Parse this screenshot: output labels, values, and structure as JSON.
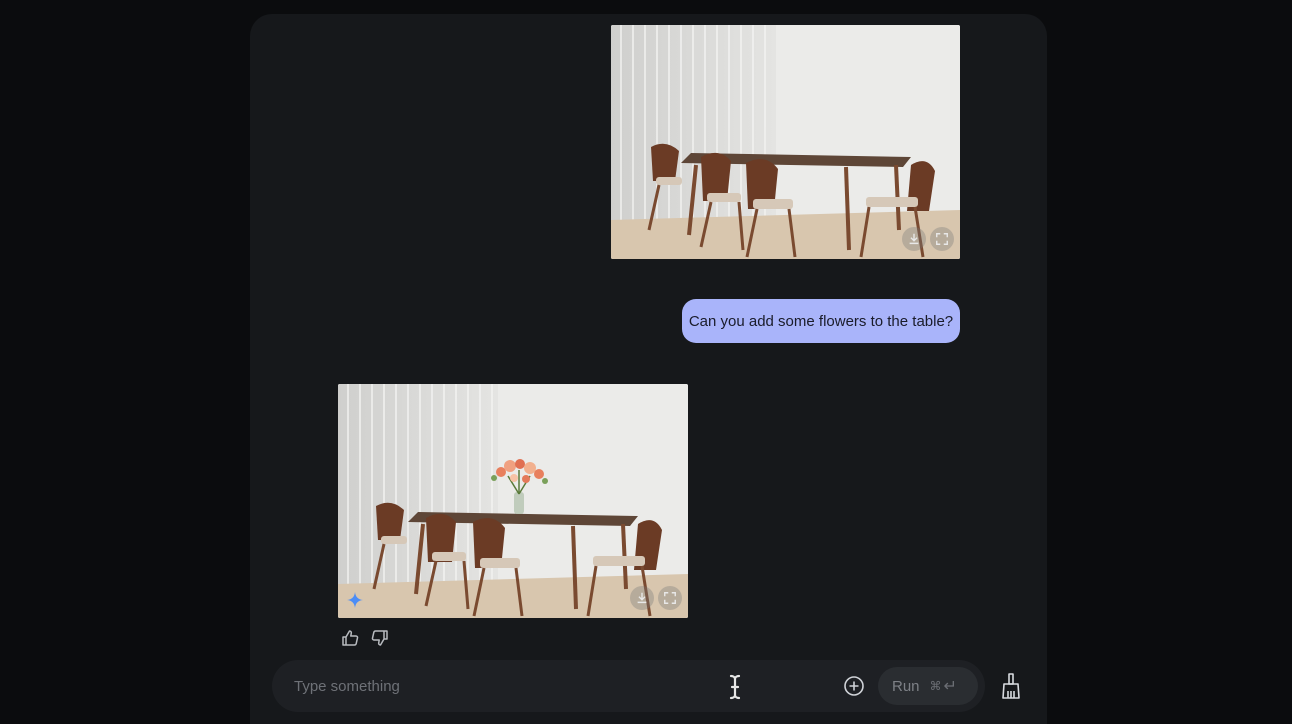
{
  "chat": {
    "user_image_alt": "Dining room with wooden table and chairs",
    "user_prompt": "Can you add some flowers to the table?",
    "model_image_alt": "Dining room with flowers on the table"
  },
  "composer": {
    "placeholder": "Type something",
    "value": "",
    "run_label": "Run",
    "shortcut_cmd": "⌘",
    "shortcut_enter": "↵"
  },
  "icons": {
    "download": "download-icon",
    "fullscreen": "fullscreen-icon",
    "sparkle": "sparkle-icon",
    "thumbs_up": "thumbs-up-icon",
    "thumbs_down": "thumbs-down-icon",
    "add": "add-circle-icon",
    "text_cursor": "text-cursor-icon",
    "clear": "broom-icon"
  },
  "colors": {
    "page_bg": "#0b0c0e",
    "panel_bg": "#16181b",
    "bubble_bg": "#a9b4fa",
    "composer_bg": "#1e2024",
    "sparkle": "#4c8df6"
  }
}
